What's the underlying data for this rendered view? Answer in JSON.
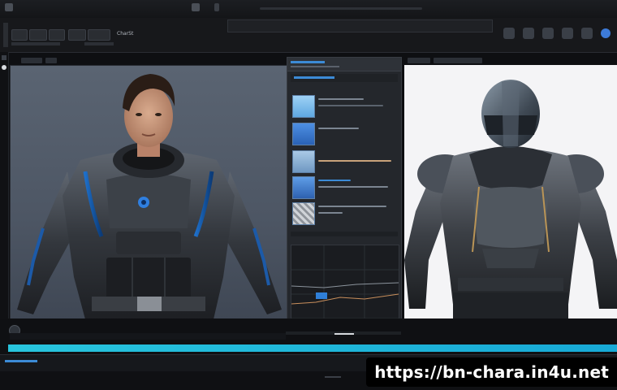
{
  "app": {
    "toolbar_label_1": "CharSt",
    "toolbar_label_2": "Char"
  },
  "icons": {
    "menu": "hamburger-icon",
    "play": "play-icon",
    "settings": "gear-icon",
    "tools": [
      "grid-icon",
      "brush-icon",
      "camera-icon",
      "light-icon",
      "globe-icon"
    ]
  },
  "viewport_left": {
    "background": "#525c69"
  },
  "viewport_right": {
    "background": "#f4f4f6"
  },
  "timeline": {
    "accent": "#23bcd9"
  },
  "watermark": {
    "url": "https://bn-chara.in4u.net"
  }
}
